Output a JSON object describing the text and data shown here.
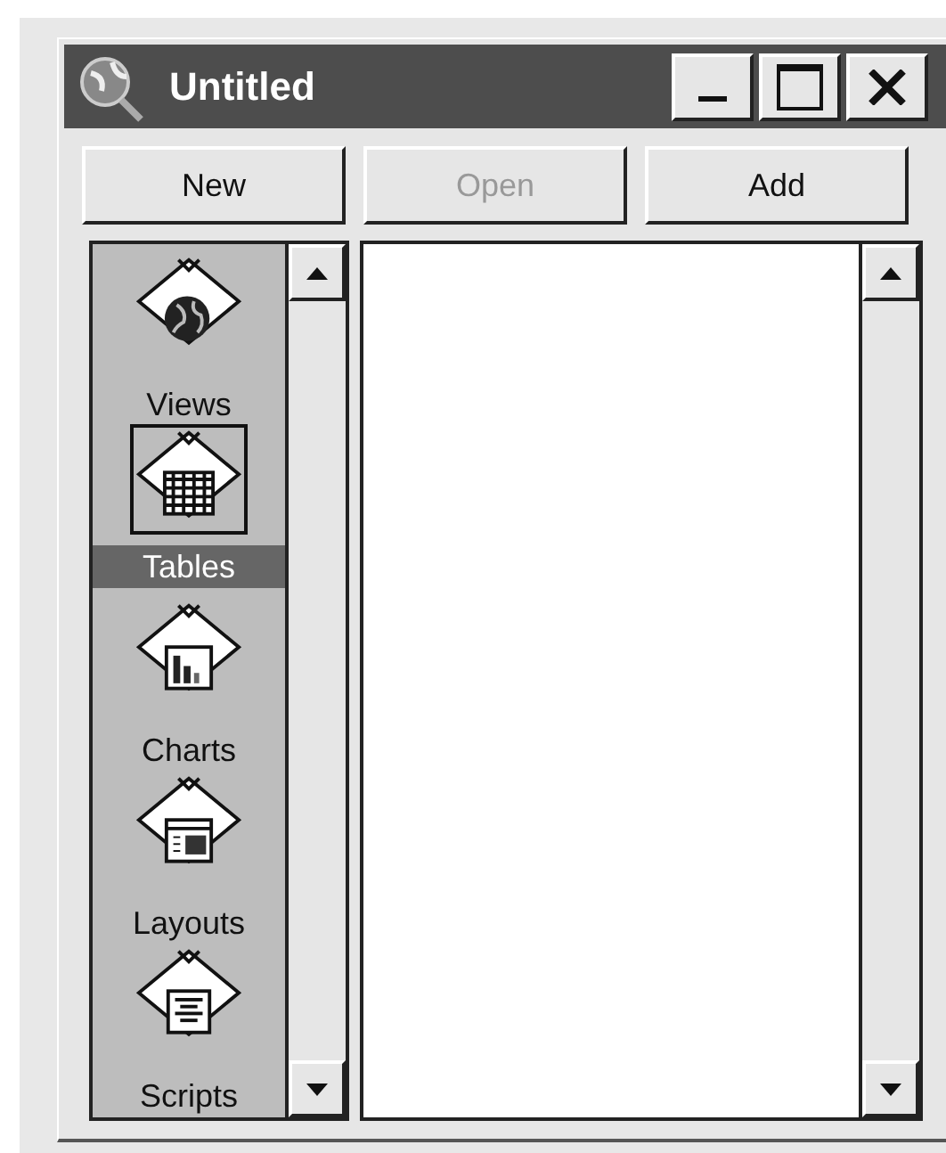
{
  "window": {
    "title": "Untitled"
  },
  "buttons": [
    {
      "label": "New",
      "disabled": false
    },
    {
      "label": "Open",
      "disabled": true
    },
    {
      "label": "Add",
      "disabled": false
    }
  ],
  "categories": [
    {
      "label": "Views",
      "kind": "views",
      "selected": false
    },
    {
      "label": "Tables",
      "kind": "tables",
      "selected": true
    },
    {
      "label": "Charts",
      "kind": "charts",
      "selected": false
    },
    {
      "label": "Layouts",
      "kind": "layouts",
      "selected": false
    },
    {
      "label": "Scripts",
      "kind": "scripts",
      "selected": false
    }
  ]
}
